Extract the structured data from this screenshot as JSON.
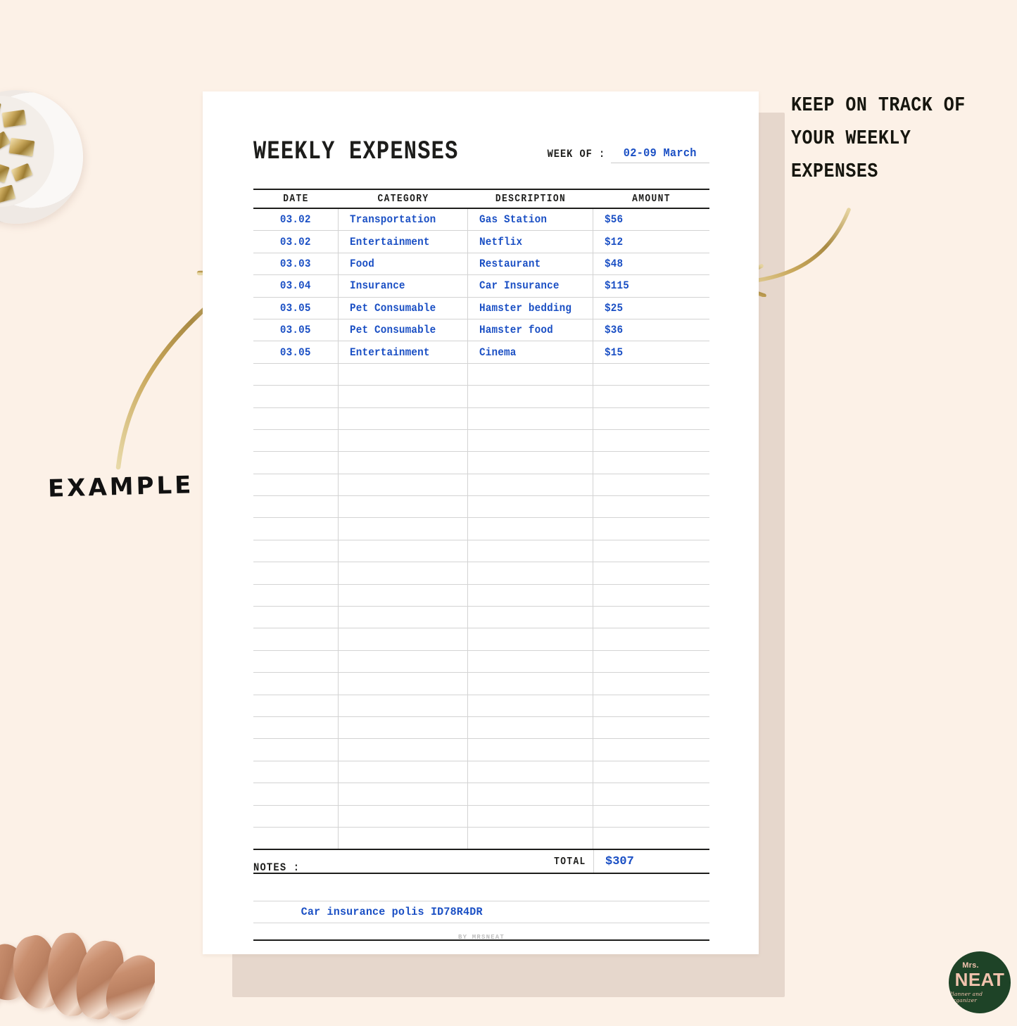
{
  "promo": {
    "lines": [
      "KEEP ON TRACK OF",
      "YOUR WEEKLY",
      "EXPENSES"
    ]
  },
  "example_label": "EXAMPLE",
  "document": {
    "title": "WEEKLY EXPENSES",
    "week_of_label": "WEEK OF :",
    "week_of_value": "02-09 March",
    "columns": [
      "DATE",
      "CATEGORY",
      "DESCRIPTION",
      "AMOUNT"
    ],
    "rows": [
      {
        "date": "03.02",
        "category": "Transportation",
        "description": "Gas Station",
        "amount": "$56"
      },
      {
        "date": "03.02",
        "category": "Entertainment",
        "description": "Netflix",
        "amount": "$12"
      },
      {
        "date": "03.03",
        "category": "Food",
        "description": "Restaurant",
        "amount": "$48"
      },
      {
        "date": "03.04",
        "category": "Insurance",
        "description": "Car Insurance",
        "amount": "$115"
      },
      {
        "date": "03.05",
        "category": "Pet Consumable",
        "description": "Hamster bedding",
        "amount": "$25"
      },
      {
        "date": "03.05",
        "category": "Pet Consumable",
        "description": "Hamster food",
        "amount": "$36"
      },
      {
        "date": "03.05",
        "category": "Entertainment",
        "description": "Cinema",
        "amount": "$15"
      },
      {
        "date": "",
        "category": "",
        "description": "",
        "amount": ""
      },
      {
        "date": "",
        "category": "",
        "description": "",
        "amount": ""
      },
      {
        "date": "",
        "category": "",
        "description": "",
        "amount": ""
      },
      {
        "date": "",
        "category": "",
        "description": "",
        "amount": ""
      },
      {
        "date": "",
        "category": "",
        "description": "",
        "amount": ""
      },
      {
        "date": "",
        "category": "",
        "description": "",
        "amount": ""
      },
      {
        "date": "",
        "category": "",
        "description": "",
        "amount": ""
      },
      {
        "date": "",
        "category": "",
        "description": "",
        "amount": ""
      },
      {
        "date": "",
        "category": "",
        "description": "",
        "amount": ""
      },
      {
        "date": "",
        "category": "",
        "description": "",
        "amount": ""
      },
      {
        "date": "",
        "category": "",
        "description": "",
        "amount": ""
      },
      {
        "date": "",
        "category": "",
        "description": "",
        "amount": ""
      },
      {
        "date": "",
        "category": "",
        "description": "",
        "amount": ""
      },
      {
        "date": "",
        "category": "",
        "description": "",
        "amount": ""
      },
      {
        "date": "",
        "category": "",
        "description": "",
        "amount": ""
      },
      {
        "date": "",
        "category": "",
        "description": "",
        "amount": ""
      },
      {
        "date": "",
        "category": "",
        "description": "",
        "amount": ""
      },
      {
        "date": "",
        "category": "",
        "description": "",
        "amount": ""
      },
      {
        "date": "",
        "category": "",
        "description": "",
        "amount": ""
      },
      {
        "date": "",
        "category": "",
        "description": "",
        "amount": ""
      },
      {
        "date": "",
        "category": "",
        "description": "",
        "amount": ""
      },
      {
        "date": "",
        "category": "",
        "description": "",
        "amount": ""
      }
    ],
    "total_label": "TOTAL",
    "total_value": "$307",
    "notes_label": "NOTES :",
    "note_text": "Car insurance polis ID78R4DR",
    "byline": "BY MRSNEAT"
  },
  "logo": {
    "top": "Mrs.",
    "name": "NEAT",
    "tagline": "Planner and Organizer"
  },
  "colors": {
    "page_background": "#FCF1E7",
    "paper": "#FFFFFF",
    "shadow_strip": "#E6D7CC",
    "ink": "#1D1D1B",
    "handwriting_blue": "#1A4FC4",
    "rule_light": "#D3D3D3",
    "logo_green": "#1E4327",
    "logo_pink": "#F2C3AE",
    "gold": "#C9A85C"
  }
}
